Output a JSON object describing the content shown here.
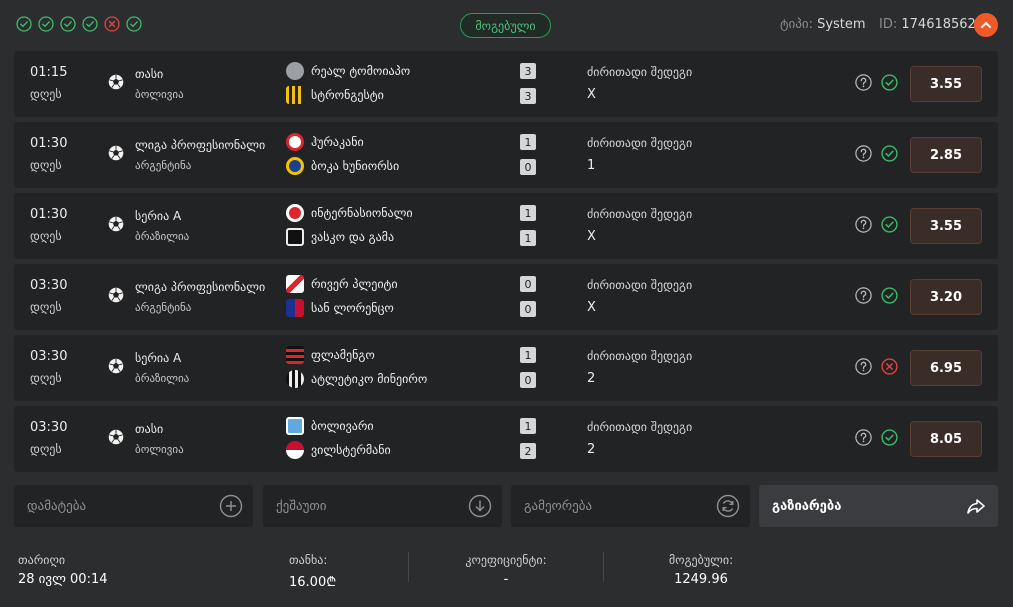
{
  "header": {
    "status_dots": [
      "won",
      "won",
      "won",
      "won",
      "lost",
      "won"
    ],
    "status_label": "მოგებული",
    "type_prefix": "ტიპი:",
    "type_value": "System",
    "id_prefix": "ID:",
    "id_value": "174618562"
  },
  "colors": {
    "accent": "#f05a28",
    "won": "#3dbb6b",
    "lost": "#e0443e"
  },
  "bets": [
    {
      "time": "01:15",
      "day": "დღეს",
      "league": "თასი",
      "country": "ბოლივია",
      "home": "რეალ ტომოიაპო",
      "away": "სტრონგესტი",
      "home_score": "3",
      "away_score": "3",
      "market": "ძირითადი შედეგი",
      "pick": "X",
      "odds": "3.55",
      "result": "won",
      "home_logo": "globe-icon",
      "away_logo": "striped-shield-icon"
    },
    {
      "time": "01:30",
      "day": "დღეს",
      "league": "ლიგა პროფესიონალი",
      "country": "არგენტინა",
      "home": "ჰურაკანი",
      "away": "ბოკა ხუნიორსი",
      "home_score": "1",
      "away_score": "0",
      "market": "ძირითადი შედეგი",
      "pick": "1",
      "odds": "2.85",
      "result": "won",
      "home_logo": "red-crest-icon",
      "away_logo": "blue-crest-icon"
    },
    {
      "time": "01:30",
      "day": "დღეს",
      "league": "სერია A",
      "country": "ბრაზილია",
      "home": "ინტერნასიონალი",
      "away": "ვასკო და გამა",
      "home_score": "1",
      "away_score": "1",
      "market": "ძირითადი შედეგი",
      "pick": "X",
      "odds": "3.55",
      "result": "won",
      "home_logo": "red-circle-crest-icon",
      "away_logo": "black-shield-icon"
    },
    {
      "time": "03:30",
      "day": "დღეს",
      "league": "ლიგა პროფესიონალი",
      "country": "არგენტინა",
      "home": "რივერ პლეიტი",
      "away": "სან ლორენცო",
      "home_score": "0",
      "away_score": "0",
      "market": "ძირითადი შედეგი",
      "pick": "X",
      "odds": "3.20",
      "result": "won",
      "home_logo": "white-red-shield-icon",
      "away_logo": "blue-red-shield-icon"
    },
    {
      "time": "03:30",
      "day": "დღეს",
      "league": "სერია A",
      "country": "ბრაზილია",
      "home": "ფლამენგო",
      "away": "ატლეტიკო მინეირო",
      "home_score": "1",
      "away_score": "0",
      "market": "ძირითადი შედეგი",
      "pick": "2",
      "odds": "6.95",
      "result": "lost",
      "home_logo": "red-black-crest-icon",
      "away_logo": "black-white-crest-icon"
    },
    {
      "time": "03:30",
      "day": "დღეს",
      "league": "თასი",
      "country": "ბოლივია",
      "home": "ბოლივარი",
      "away": "ვილსტერმანი",
      "home_score": "1",
      "away_score": "2",
      "market": "ძირითადი შედეგი",
      "pick": "2",
      "odds": "8.05",
      "result": "won",
      "home_logo": "sky-blue-shield-icon",
      "away_logo": "red-white-crest-icon"
    }
  ],
  "actions": {
    "add": "დამატება",
    "cashout": "ქეშაუთი",
    "repeat": "გამეორება",
    "share": "გაზიარება"
  },
  "footer": {
    "date_label": "თარიღი",
    "date_value": "28 ივლ 00:14",
    "stake_label": "თანხა:",
    "stake_value": "16.00₾",
    "coef_label": "კოეფიციენტი:",
    "coef_value": "-",
    "won_label": "მოგებული:",
    "won_value": "1249.96"
  }
}
